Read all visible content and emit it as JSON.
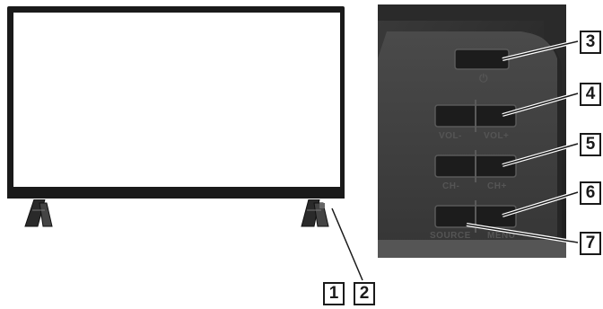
{
  "callouts": {
    "c1": "1",
    "c2": "2",
    "c3": "3",
    "c4": "4",
    "c5": "5",
    "c6": "6",
    "c7": "7"
  },
  "buttons": {
    "vol_minus": "VOL-",
    "vol_plus": "VOL+",
    "ch_minus": "CH-",
    "ch_plus": "CH+",
    "source": "SOURCE",
    "menu": "MENU",
    "power_symbol": "⏻"
  },
  "colors": {
    "tv_bezel": "#1a1a1a",
    "panel_body": "#3a3a3a",
    "callout_border": "#1a1a1a"
  }
}
